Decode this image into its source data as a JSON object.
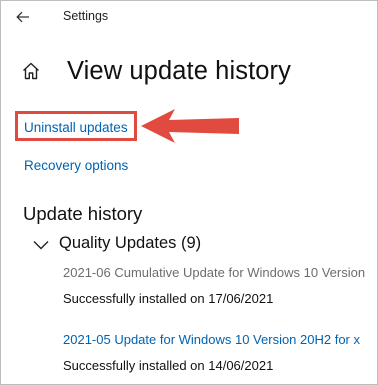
{
  "window": {
    "title": "Settings",
    "back_icon": "arrow-left-icon",
    "home_icon": "home-icon"
  },
  "page": {
    "title": "View update history"
  },
  "links": {
    "uninstall": "Uninstall updates",
    "recovery": "Recovery options"
  },
  "update_history": {
    "heading": "Update history",
    "groups": [
      {
        "label": "Quality Updates (9)",
        "expanded": true,
        "items": [
          {
            "title": "2021-06 Cumulative Update for Windows 10 Version",
            "status": "Successfully installed on 17/06/2021"
          },
          {
            "title": "2021-05 Update for Windows 10 Version 20H2 for x",
            "status": "Successfully installed on 14/06/2021"
          }
        ]
      }
    ]
  },
  "annotation": {
    "color": "#e04a3f"
  },
  "colors": {
    "link": "#0063b1",
    "muted": "#6d6d6d",
    "text": "#111111"
  }
}
